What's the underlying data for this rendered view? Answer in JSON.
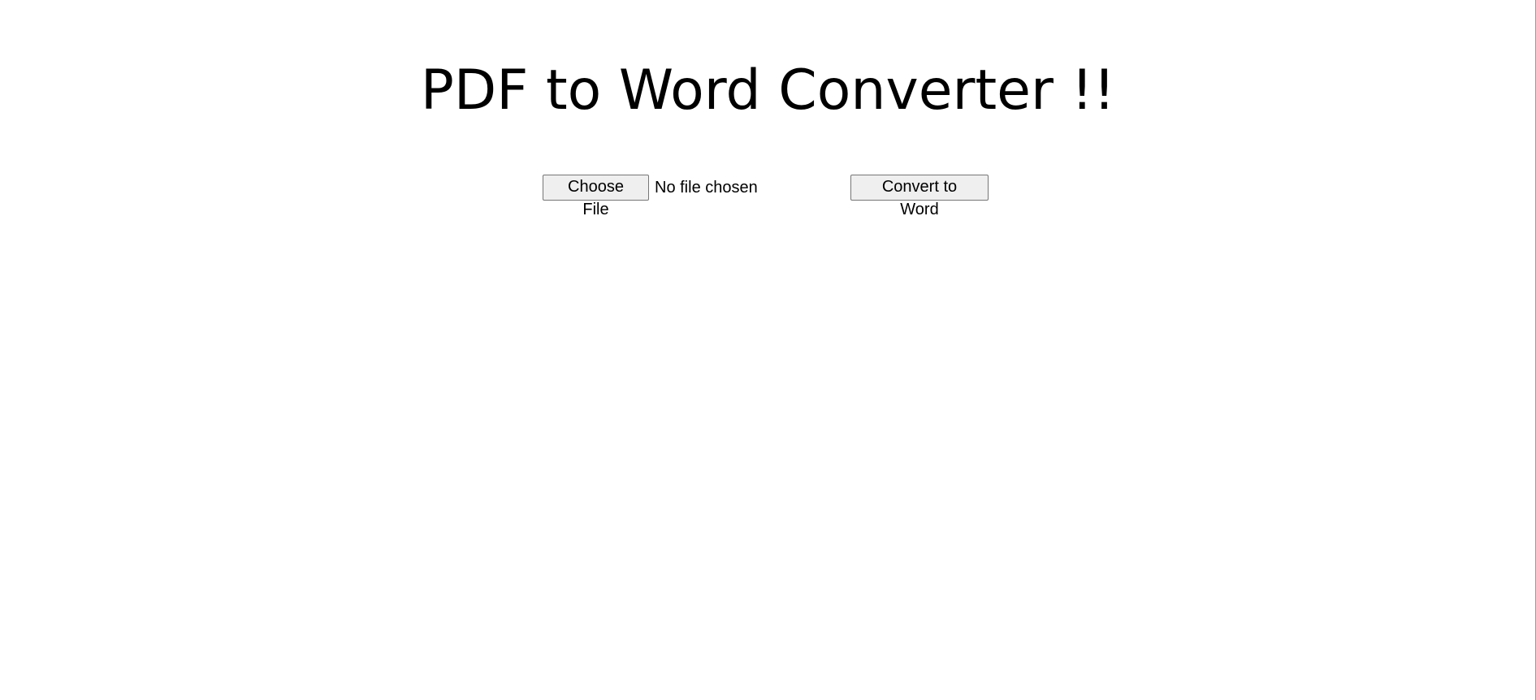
{
  "page": {
    "title": "PDF to Word Converter !!"
  },
  "form": {
    "choose_file_label": "Choose File",
    "file_status": "No file chosen",
    "convert_label": "Convert to Word"
  },
  "colors": {
    "background": "#ffffff",
    "text": "#000000",
    "button_bg": "#efefef",
    "button_border": "#767676"
  }
}
